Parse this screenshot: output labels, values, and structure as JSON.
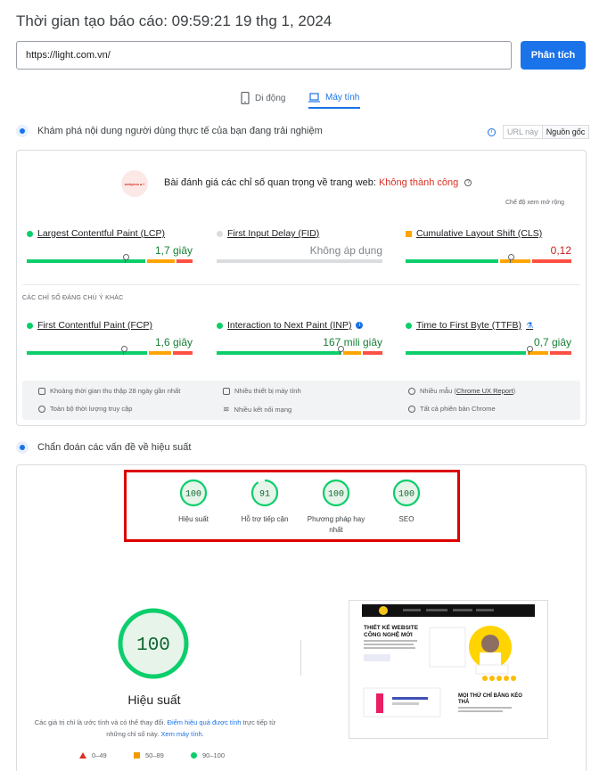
{
  "header": {
    "title": "Thời gian tạo báo cáo: 09:59:21 19 thg 1, 2024",
    "url_value": "https://light.com.vn/",
    "analyze_label": "Phân tích"
  },
  "tabs": [
    {
      "label": "Di động",
      "active": false
    },
    {
      "label": "Máy tính",
      "active": true
    }
  ],
  "field_section": {
    "heading": "Khám phá nội dung người dùng thực tế của bạn đang trải nghiệm",
    "toggle_url": "URL này",
    "toggle_origin": "Nguồn gốc",
    "logo_text": "webpros▲+",
    "assessment_prefix": "Bài đánh giá các chỉ số quan trọng về trang web:",
    "assessment_result": "Không thành công",
    "expand_label": "Chế độ xem mở rộng",
    "core_metrics": [
      {
        "name": "Largest Contentful Paint (LCP)",
        "value": "1,7 giây",
        "status": "good",
        "distribution": [
          0.73,
          0.17,
          0.1
        ],
        "marker": 0.59
      },
      {
        "name": "First Input Delay (FID)",
        "value": "Không áp dụng",
        "status": "na",
        "distribution": [],
        "marker": null
      },
      {
        "name": "Cumulative Layout Shift (CLS)",
        "value": "0,12",
        "status": "poor",
        "distribution": [
          0.57,
          0.19,
          0.24
        ],
        "marker": 0.63
      }
    ],
    "other_heading": "CÁC CHỈ SỐ ĐÁNG CHÚ Ý KHÁC",
    "other_metrics": [
      {
        "name": "First Contentful Paint (FCP)",
        "value": "1,6 giây",
        "status": "good",
        "distribution": [
          0.74,
          0.14,
          0.12
        ],
        "marker": 0.58,
        "icon": ""
      },
      {
        "name": "Interaction to Next Paint (INP)",
        "value": "167 mili giây",
        "status": "good",
        "distribution": [
          0.77,
          0.11,
          0.12
        ],
        "marker": 0.74,
        "icon": "info-icon"
      },
      {
        "name": "Time to First Byte (TTFB)",
        "value": "0,7 giây",
        "status": "good",
        "distribution": [
          0.74,
          0.13,
          0.13
        ],
        "marker": 0.74,
        "icon": "flask-icon"
      }
    ],
    "info": [
      {
        "icon": "calendar-icon",
        "text": "Khoảng thời gian thu thập 28 ngày gần nhất"
      },
      {
        "icon": "desktop-icon",
        "text": "Nhiều thiết bị máy tính"
      },
      {
        "icon": "samples-icon",
        "text": "Nhiều mẫu (",
        "link": "Chrome UX Report",
        "suffix": ")"
      },
      {
        "icon": "timer-icon",
        "text": "Toàn bộ thời lượng truy cập"
      },
      {
        "icon": "wifi-icon",
        "text": "Nhiều kết nối mạng"
      },
      {
        "icon": "chrome-icon",
        "text": "Tất cả phiên bản Chrome"
      }
    ]
  },
  "lab_section": {
    "heading": "Chẩn đoán các vấn đề về hiệu suất",
    "scores": [
      {
        "value": "100",
        "label": "Hiệu suất",
        "fraction": 1.0
      },
      {
        "value": "91",
        "label": "Hỗ trợ tiếp cận",
        "fraction": 0.91
      },
      {
        "value": "100",
        "label": "Phương pháp hay nhất",
        "fraction": 1.0
      },
      {
        "value": "100",
        "label": "SEO",
        "fraction": 1.0
      }
    ],
    "main_score": "100",
    "main_label": "Hiệu suất",
    "note_prefix": "Các giá trị chỉ là ước tính và có thể thay đổi.",
    "note_link1": "Điểm hiệu quả được tính",
    "note_middle": "trực tiếp từ những chỉ số này.",
    "note_link2": "Xem máy tính.",
    "legend": [
      {
        "range": "0–49",
        "color": "#d93025"
      },
      {
        "range": "50–89",
        "color": "#f29900"
      },
      {
        "range": "90–100",
        "color": "#0cce6b"
      }
    ],
    "screenshot": {
      "headline1": "THIẾT KẾ WEBSITE",
      "headline2": "CÔNG NGHỆ MỚI",
      "caption1": "MỌI THỨ CHỈ BẰNG KÉO",
      "caption2": "THẢ"
    }
  },
  "colors": {
    "good": "#0cce6b",
    "average": "#ffa400",
    "poor": "#ff4e42",
    "link": "#1a73e8"
  }
}
